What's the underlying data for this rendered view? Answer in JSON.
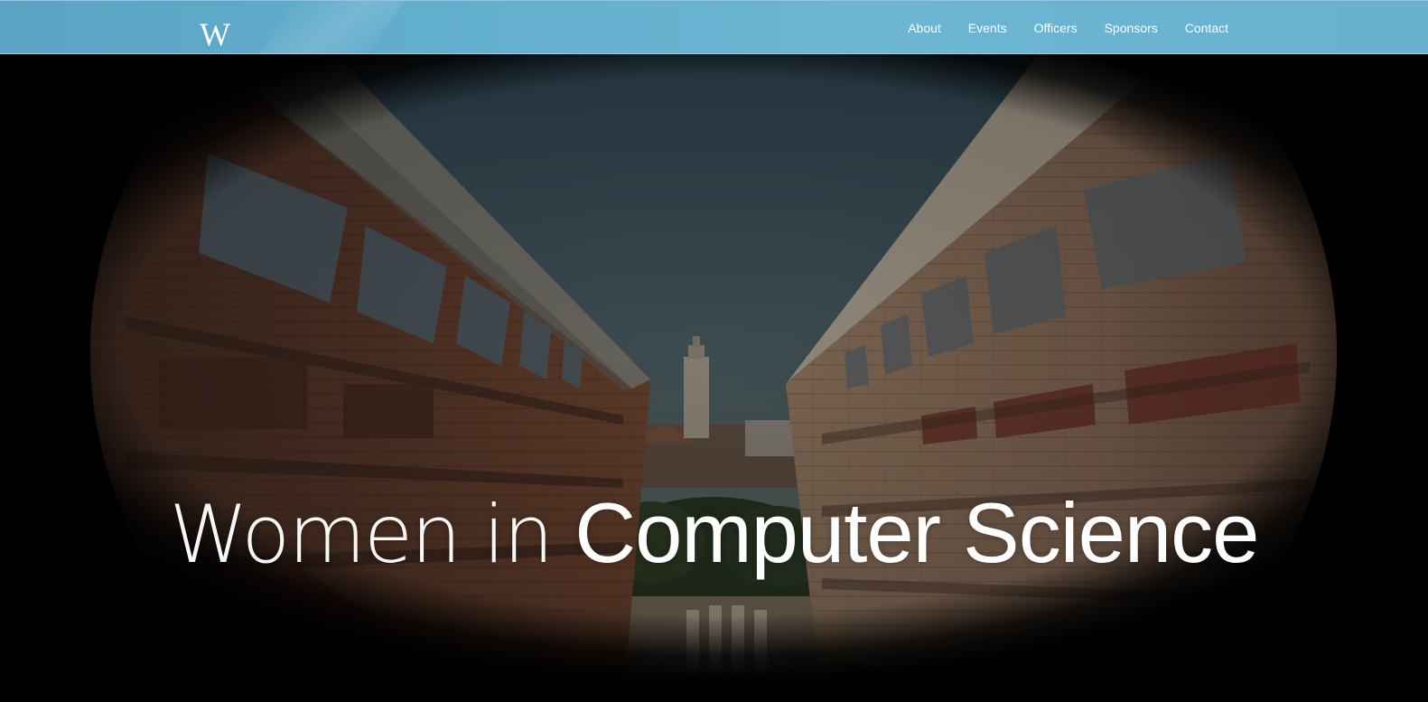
{
  "brand": {
    "logo_text": "W"
  },
  "nav": {
    "items": [
      {
        "label": "About"
      },
      {
        "label": "Events"
      },
      {
        "label": "Officers"
      },
      {
        "label": "Sponsors"
      },
      {
        "label": "Contact"
      }
    ]
  },
  "hero": {
    "title_light": "Women in",
    "title_bold": "Computer Science"
  },
  "colors": {
    "navbar": "#62aecd",
    "text": "#ffffff",
    "background": "#000000"
  }
}
